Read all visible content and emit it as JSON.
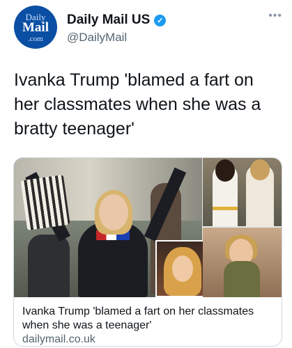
{
  "account": {
    "logo_line1": "Daily",
    "logo_line2": "Mail",
    "logo_line3": ".com",
    "display_name": "Daily Mail US",
    "handle": "@DailyMail",
    "verified_icon": "verified-badge",
    "more_icon": "more-icon"
  },
  "tweet": {
    "text": "Ivanka Trump 'blamed a fart on her classmates when she was a bratty teenager'"
  },
  "card": {
    "title": "Ivanka Trump 'blamed a fart on her classmates when she was a teenager'",
    "domain": "dailymail.co.uk"
  },
  "colors": {
    "brand": "#0a4fa3",
    "verified": "#1d9bf0",
    "secondary_text": "#536471"
  }
}
